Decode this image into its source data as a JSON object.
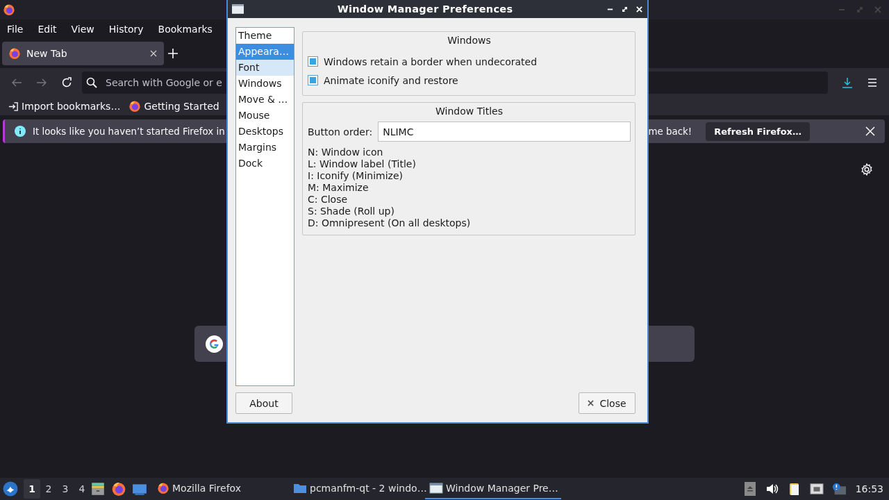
{
  "firefox": {
    "menu": [
      "File",
      "Edit",
      "View",
      "History",
      "Bookmarks"
    ],
    "tabs": [
      {
        "label": "New Tab",
        "selected": true
      }
    ],
    "address_placeholder": "Search with Google or e",
    "bookmarks": [
      {
        "kind": "import",
        "label": "Import bookmarks…"
      },
      {
        "kind": "site",
        "label": "Getting Started"
      }
    ],
    "notification": {
      "text_start": "It looks like you haven’t started Firefox in",
      "text_end": "me back!",
      "button": "Refresh Firefox…"
    }
  },
  "dialog": {
    "title": "Window Manager Preferences",
    "sections": [
      {
        "label": "Theme",
        "selected": false,
        "hovered": false
      },
      {
        "label": "Appeara…",
        "selected": true,
        "hovered": false
      },
      {
        "label": "Font",
        "selected": false,
        "hovered": true
      },
      {
        "label": "Windows",
        "selected": false,
        "hovered": false
      },
      {
        "label": "Move & …",
        "selected": false,
        "hovered": false
      },
      {
        "label": "Mouse",
        "selected": false,
        "hovered": false
      },
      {
        "label": "Desktops",
        "selected": false,
        "hovered": false
      },
      {
        "label": "Margins",
        "selected": false,
        "hovered": false
      },
      {
        "label": "Dock",
        "selected": false,
        "hovered": false
      }
    ],
    "windows_group": {
      "title": "Windows",
      "options": [
        {
          "label": "Windows retain a border when undecorated",
          "checked": true
        },
        {
          "label": "Animate iconify and restore",
          "checked": true
        }
      ]
    },
    "titles_group": {
      "title": "Window Titles",
      "button_order_label": "Button order:",
      "button_order_value": "NLIMC",
      "legend": [
        "N: Window icon",
        "L: Window label (Title)",
        "I: Iconify (Minimize)",
        "M: Maximize",
        "C: Close",
        "S: Shade (Roll up)",
        "D: Omnipresent (On all desktops)"
      ]
    },
    "about_button": "About",
    "close_button": "Close"
  },
  "taskbar": {
    "workspaces": [
      {
        "label": "1",
        "selected": true
      },
      {
        "label": "2",
        "selected": false
      },
      {
        "label": "3",
        "selected": false
      },
      {
        "label": "4",
        "selected": false
      }
    ],
    "tasks": [
      {
        "kind": "firefox",
        "label": "Mozilla Firefox",
        "selected": false
      },
      {
        "kind": "folder",
        "label": "pcmanfm-qt - 2 windo…",
        "selected": false
      },
      {
        "kind": "window",
        "label": "Window Manager Pre…",
        "selected": true
      }
    ],
    "clock": "16:53"
  }
}
